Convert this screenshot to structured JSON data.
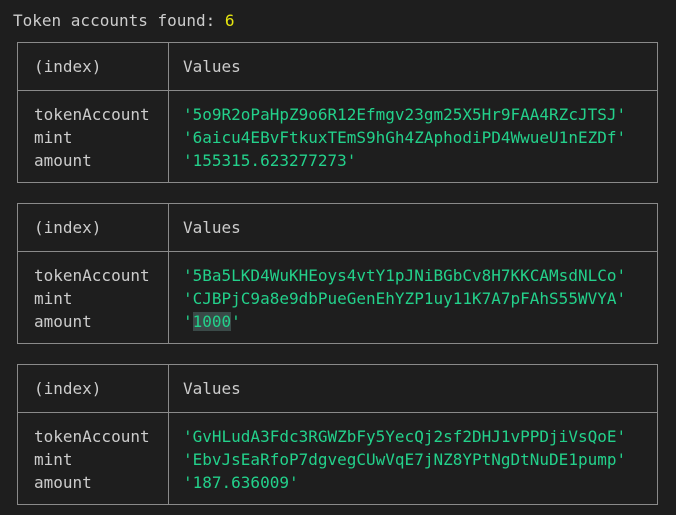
{
  "header": {
    "label": "Token accounts found: ",
    "count": "6"
  },
  "table_headers": {
    "index": "(index)",
    "values": "Values"
  },
  "row_keys": [
    "tokenAccount",
    "mint",
    "amount"
  ],
  "tables": [
    {
      "tokenAccount": "'5o9R2oPaHpZ9o6R12Efmgv23gm25X5Hr9FAA4RZcJTSJ'",
      "mint": "'6aicu4EBvFtkuxTEmS9hGh4ZAphodiPD4WwueU1nEZDf'",
      "amount": "'155315.623277273'"
    },
    {
      "tokenAccount": "'5Ba5LKD4WuKHEoys4vtY1pJNiBGbCv8H7KKCAMsdNLCo'",
      "mint": "'CJBPjC9a8e9dbPueGenEhYZP1uy11K7A7pFAhS55WVYA'",
      "amount_prefix": "'",
      "amount_selected": "1000",
      "amount_suffix": "'"
    },
    {
      "tokenAccount": "'GvHLudA3Fdc3RGWZbFy5YecQj2sf2DHJ1vPPDjiVsQoE'",
      "mint": "'EbvJsEaRfoP7dgvegCUwVqE7jNZ8YPtNgDtNuDE1pump'",
      "amount": "'187.636009'"
    }
  ],
  "colors": {
    "background": "#1e1e1e",
    "text": "#cccccc",
    "number": "#e5e510",
    "string": "#23d18b",
    "border": "#8a8a8a"
  }
}
